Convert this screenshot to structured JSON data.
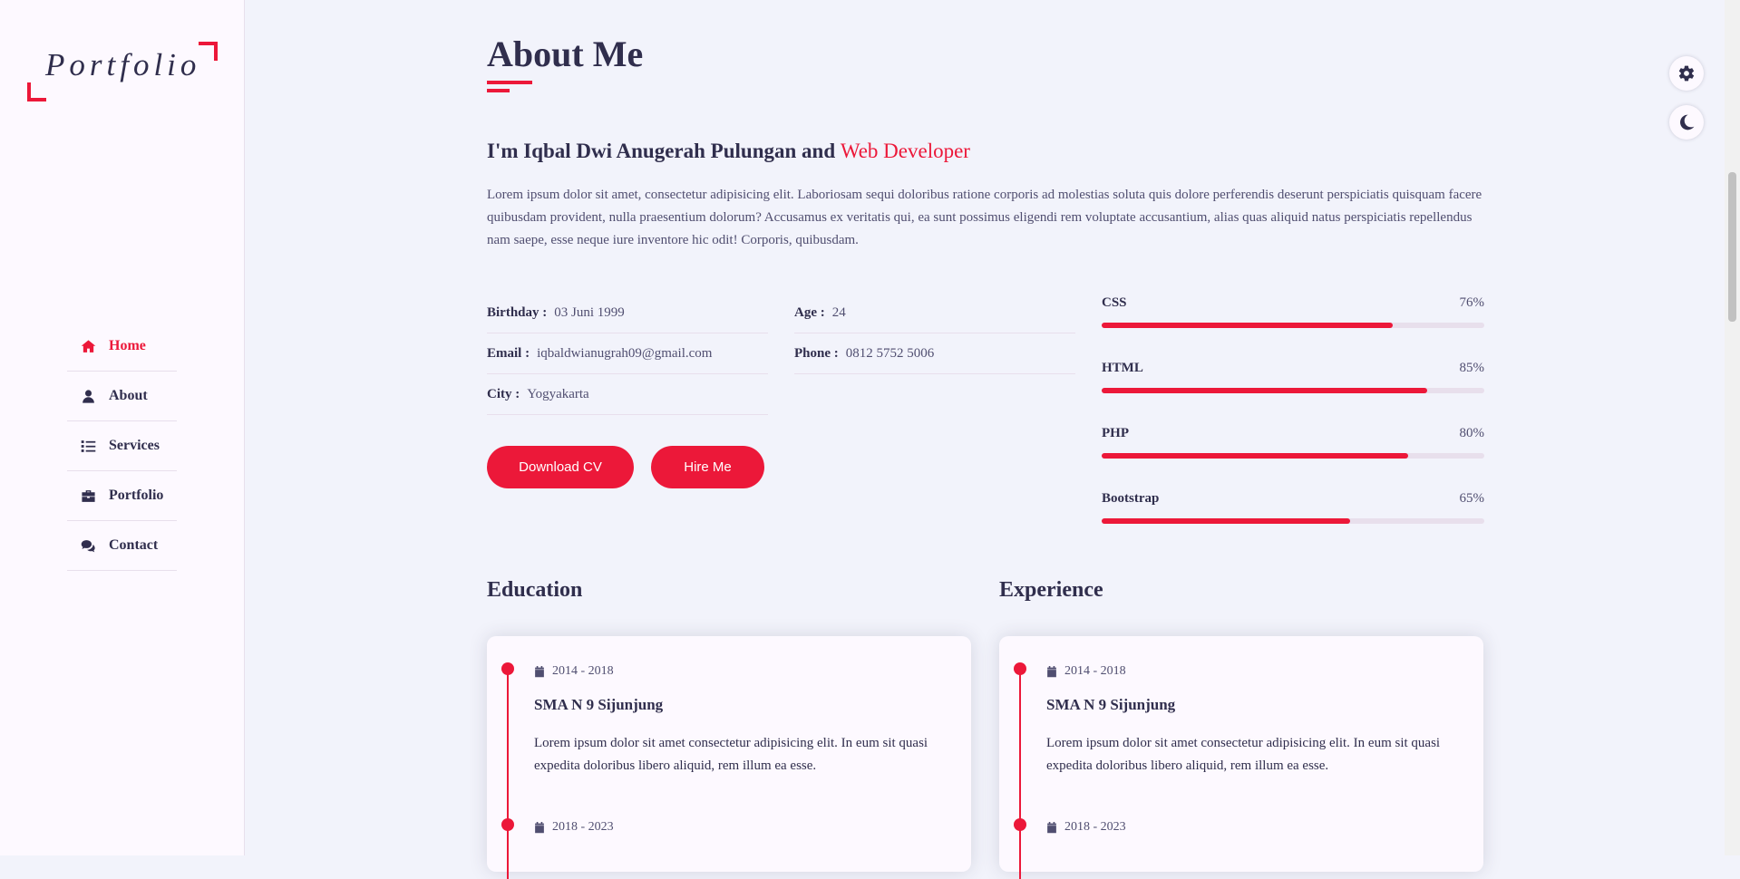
{
  "sidebar": {
    "logo": "Portfolio",
    "nav": [
      {
        "label": "Home",
        "icon": "home-icon",
        "active": true
      },
      {
        "label": "About",
        "icon": "user-icon",
        "active": false
      },
      {
        "label": "Services",
        "icon": "list-icon",
        "active": false
      },
      {
        "label": "Portfolio",
        "icon": "briefcase-icon",
        "active": false
      },
      {
        "label": "Contact",
        "icon": "comments-icon",
        "active": false
      }
    ]
  },
  "about": {
    "title": "About Me",
    "intro_prefix": "I'm Iqbal Dwi Anugerah Pulungan and ",
    "intro_accent": "Web Developer",
    "text": "Lorem ipsum dolor sit amet, consectetur adipisicing elit. Laboriosam sequi doloribus ratione corporis ad molestias soluta quis dolore perferendis deserunt perspiciatis quisquam facere quibusdam provident, nulla praesentium dolorum? Accusamus ex veritatis qui, ea sunt possimus eligendi rem voluptate accusantium, alias quas aliquid natus perspiciatis repellendus nam saepe, esse neque iure inventore hic odit! Corporis, quibusdam.",
    "info_left": [
      {
        "label": "Birthday :",
        "value": "03 Juni 1999"
      },
      {
        "label": "Email :",
        "value": "iqbaldwianugrah09@gmail.com"
      },
      {
        "label": "City :",
        "value": "Yogyakarta"
      }
    ],
    "info_right": [
      {
        "label": "Age :",
        "value": "24"
      },
      {
        "label": "Phone :",
        "value": "0812 5752 5006"
      }
    ],
    "buttons": {
      "download": "Download CV",
      "hire": "Hire Me"
    },
    "skills": [
      {
        "name": "CSS",
        "percent_label": "76%",
        "level": 76
      },
      {
        "name": "HTML",
        "percent_label": "85%",
        "level": 85
      },
      {
        "name": "PHP",
        "percent_label": "80%",
        "level": 80
      },
      {
        "name": "Bootstrap",
        "percent_label": "65%",
        "level": 65
      }
    ]
  },
  "education": {
    "title": "Education",
    "items": [
      {
        "date": "2014 - 2018",
        "school": "SMA N 9 Sijunjung",
        "desc": "Lorem ipsum dolor sit amet consectetur adipisicing elit. In eum sit quasi expedita doloribus libero aliquid, rem illum ea esse."
      },
      {
        "date": "2018 - 2023"
      }
    ]
  },
  "experience": {
    "title": "Experience",
    "items": [
      {
        "date": "2014 - 2018",
        "school": "SMA N 9 Sijunjung",
        "desc": "Lorem ipsum dolor sit amet consectetur adipisicing elit. In eum sit quasi expedita doloribus libero aliquid, rem illum ea esse."
      },
      {
        "date": "2018 - 2023"
      }
    ]
  },
  "colors": {
    "accent": "#ec1839",
    "text": "#302e4d",
    "background": "#f2f3fb",
    "sidebar": "#fdf9ff"
  }
}
